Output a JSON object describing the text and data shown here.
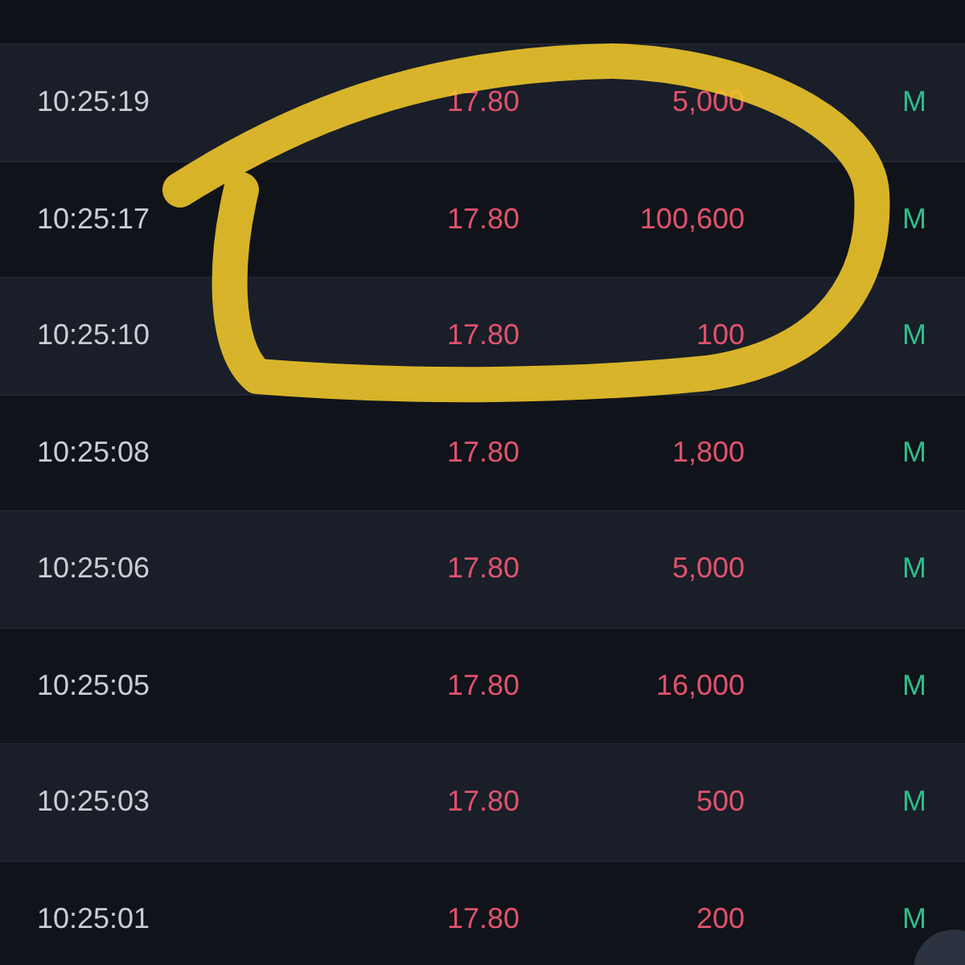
{
  "trades": [
    {
      "time": "10:25:19",
      "price": "17.80",
      "quantity": "5,000",
      "type": "M"
    },
    {
      "time": "10:25:17",
      "price": "17.80",
      "quantity": "100,600",
      "type": "M"
    },
    {
      "time": "10:25:10",
      "price": "17.80",
      "quantity": "100",
      "type": "M"
    },
    {
      "time": "10:25:08",
      "price": "17.80",
      "quantity": "1,800",
      "type": "M"
    },
    {
      "time": "10:25:06",
      "price": "17.80",
      "quantity": "5,000",
      "type": "M"
    },
    {
      "time": "10:25:05",
      "price": "17.80",
      "quantity": "16,000",
      "type": "M"
    },
    {
      "time": "10:25:03",
      "price": "17.80",
      "quantity": "500",
      "type": "M"
    },
    {
      "time": "10:25:01",
      "price": "17.80",
      "quantity": "200",
      "type": "M"
    }
  ]
}
